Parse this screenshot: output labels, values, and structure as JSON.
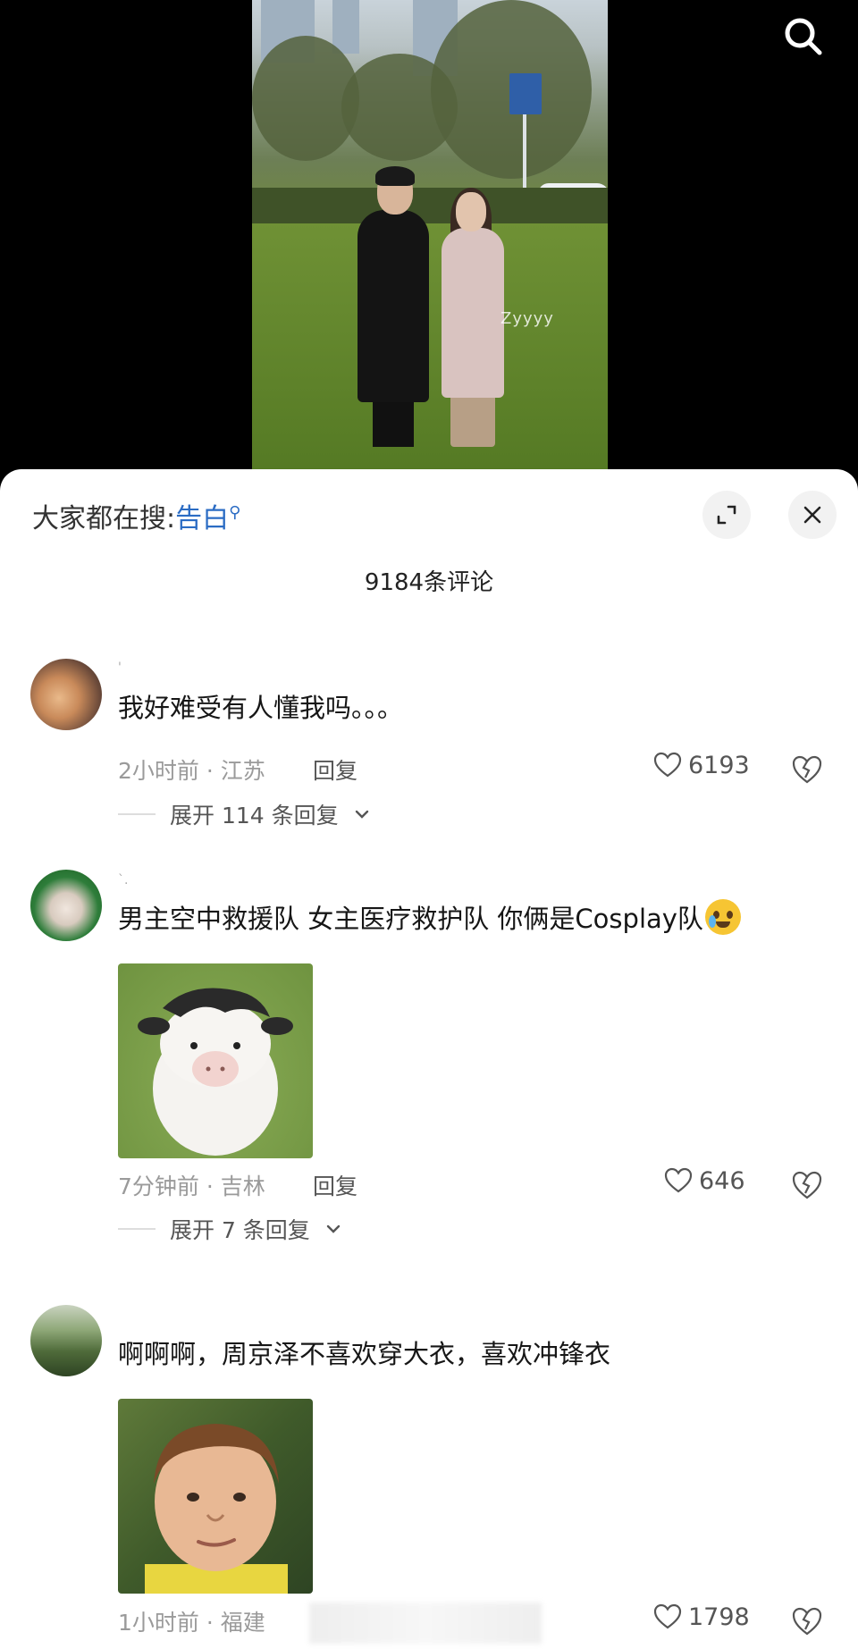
{
  "video": {
    "watermark": "Zyyyy"
  },
  "sheet": {
    "trending_prefix": "大家都在搜:",
    "trending_keyword": "告白",
    "comment_count": "9184条评论"
  },
  "comments": [
    {
      "username": "'",
      "text": "我好难受有人懂我吗。。。",
      "time_location": "2小时前 · 江苏",
      "reply_label": "回复",
      "likes": "6193",
      "expand_label": "展开 114 条回复"
    },
    {
      "username": "`.",
      "text": "男主空中救援队 女主医疗救护队 你俩是Cosplay队",
      "emoji": "crying-laugh-emoji",
      "time_location": "7分钟前 · 吉林",
      "reply_label": "回复",
      "likes": "646",
      "expand_label": "展开 7 条回复"
    },
    {
      "username": "",
      "text": "啊啊啊，周京泽不喜欢穿大衣，喜欢冲锋衣",
      "time_location": "1小时前 · 福建",
      "reply_label": "回复",
      "likes": "1798"
    }
  ],
  "colors": {
    "accent_link": "#2b6cc4",
    "background": "#000000",
    "sheet": "#ffffff"
  }
}
